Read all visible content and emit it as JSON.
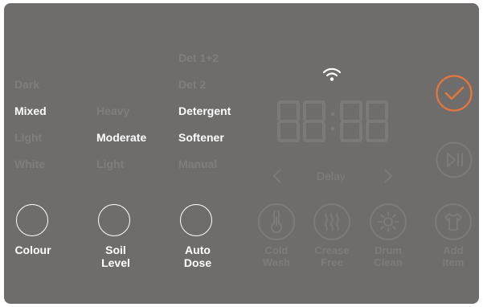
{
  "soil_dial": {
    "colour_options": [
      "Dark",
      "Mixed",
      "Light",
      "White"
    ],
    "colour_selected": "Mixed",
    "level_options": [
      "Heavy",
      "Moderate",
      "Light"
    ],
    "level_selected": "Moderate",
    "dose_options": [
      "Det 1+2",
      "Det 2",
      "Detergent",
      "Softener",
      "Manual"
    ],
    "dose_selected": [
      "Detergent",
      "Softener"
    ]
  },
  "buttons": {
    "colour": "Colour",
    "soil_level_line1": "Soil",
    "soil_level_line2": "Level",
    "auto_dose_line1": "Auto",
    "auto_dose_line2": "Dose"
  },
  "display": {
    "time": "88:88",
    "delay_label": "Delay"
  },
  "options": [
    {
      "line1": "Cold",
      "line2": "Wash",
      "icon": "thermometer-icon"
    },
    {
      "line1": "Crease",
      "line2": "Free",
      "icon": "steam-icon"
    },
    {
      "line1": "Drum",
      "line2": "Clean",
      "icon": "drum-clean-icon"
    },
    {
      "line1": "Add",
      "line2": "Item",
      "icon": "shirt-icon"
    }
  ],
  "colors": {
    "panel": "#6e6d6c",
    "active_text": "#ffffff",
    "inactive_text": "#7f7e7c",
    "start_accent": "#e8763a"
  }
}
